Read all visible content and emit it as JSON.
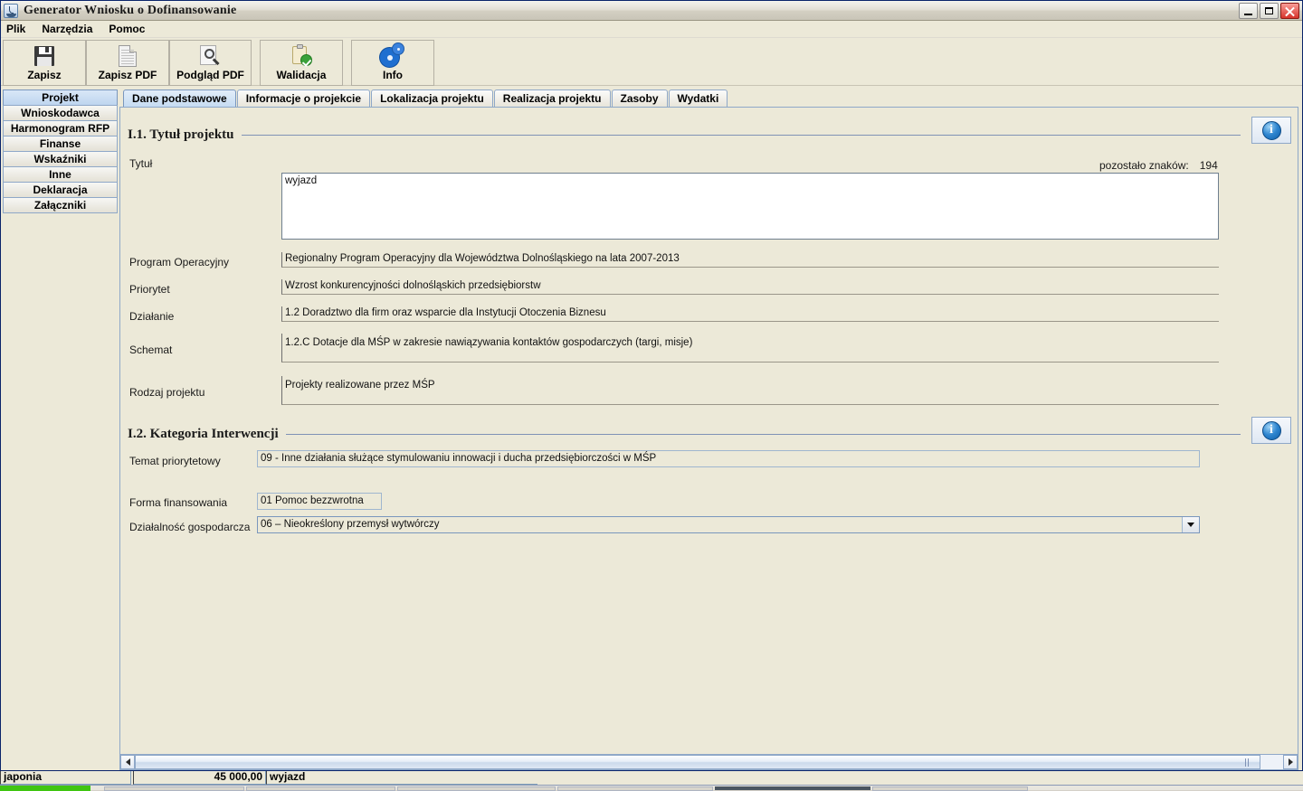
{
  "window": {
    "title": "Generator Wniosku o Dofinansowanie",
    "icon": "java-coffee-icon",
    "minimize_label": "",
    "maximize_label": "",
    "close_label": ""
  },
  "menu": {
    "items": [
      {
        "label": "Plik"
      },
      {
        "label": "Narzędzia"
      },
      {
        "label": "Pomoc"
      }
    ]
  },
  "toolbar": {
    "buttons": [
      {
        "label": "Zapisz",
        "icon": "floppy-disk-icon"
      },
      {
        "label": "Zapisz PDF",
        "icon": "pdf-document-icon"
      },
      {
        "label": "Podgląd PDF",
        "icon": "document-magnifier-icon"
      },
      {
        "label": "Walidacja",
        "icon": "clipboard-check-icon"
      },
      {
        "label": "Info",
        "icon": "gears-icon"
      }
    ]
  },
  "sidebar": {
    "items": [
      {
        "label": "Projekt",
        "active": true
      },
      {
        "label": "Wnioskodawca",
        "active": false
      },
      {
        "label": "Harmonogram RFP",
        "active": false
      },
      {
        "label": "Finanse",
        "active": false
      },
      {
        "label": "Wskaźniki",
        "active": false
      },
      {
        "label": "Inne",
        "active": false
      },
      {
        "label": "Deklaracja",
        "active": false
      },
      {
        "label": "Załączniki",
        "active": false
      }
    ]
  },
  "tabs": [
    {
      "label": "Dane podstawowe",
      "active": true
    },
    {
      "label": "Informacje o projekcie",
      "active": false
    },
    {
      "label": "Lokalizacja projektu",
      "active": false
    },
    {
      "label": "Realizacja projektu",
      "active": false
    },
    {
      "label": "Zasoby",
      "active": false
    },
    {
      "label": "Wydatki",
      "active": false
    }
  ],
  "section1": {
    "heading": "I.1. Tytuł projektu",
    "info_icon": "info-icon",
    "title_label": "Tytuł",
    "counter_label": "pozostało znaków:",
    "counter_value": "194",
    "title_value": "wyjazd",
    "fields": [
      {
        "label": "Program Operacyjny",
        "value": "Regionalny Program Operacyjny dla Województwa Dolnośląskiego na lata 2007-2013"
      },
      {
        "label": "Priorytet",
        "value": "Wzrost konkurencyjności dolnośląskich przedsiębiorstw"
      },
      {
        "label": "Działanie",
        "value": "1.2 Doradztwo dla firm oraz wsparcie dla Instytucji Otoczenia Biznesu"
      },
      {
        "label": "Schemat",
        "value": "1.2.C Dotacje dla MŚP w zakresie nawiązywania kontaktów gospodarczych (targi, misje)"
      },
      {
        "label": "Rodzaj projektu",
        "value": "Projekty realizowane przez MŚP"
      }
    ]
  },
  "section2": {
    "heading": "I.2. Kategoria Interwencji",
    "info_icon": "info-icon",
    "temat_label": "Temat priorytetowy",
    "temat_value": "09 - Inne działania służące stymulowaniu innowacji i ducha przedsiębiorczości w MŚP",
    "forma_label": "Forma finansowania",
    "forma_value": "01 Pomoc bezzwrotna",
    "dzialalnosc_label": "Działalność gospodarcza",
    "dzialalnosc_value": "06 – Nieokreślony przemysł wytwórczy",
    "dropdown_icon": "chevron-down-icon"
  },
  "scrollbar": {
    "left_icon": "arrow-left-icon",
    "right_icon": "arrow-right-icon"
  },
  "background_window": {
    "field1": "japonia",
    "field2": "45 000,00",
    "field3": "wyjazd"
  },
  "colors": {
    "accent_blue": "#7a97bd",
    "window_bg": "#ece9d8",
    "tab_active": "#c6dcf2",
    "rule": "#7f92b5",
    "info_blue": "#2f86d0",
    "taskbar_green": "#3fc511"
  }
}
